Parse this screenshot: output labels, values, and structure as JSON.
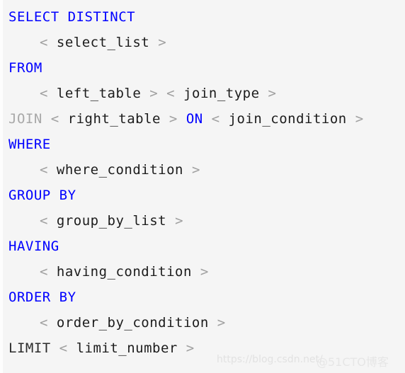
{
  "code": {
    "language": "sql",
    "background_color": "#f5f5f5",
    "keyword_color": "#0000ff",
    "placeholder_color": "#1c1c1c",
    "bracket_color": "#a0a0a0",
    "lines": [
      {
        "id": "line-select",
        "indented": false,
        "tokens": [
          {
            "text": "SELECT",
            "type": "keyword"
          },
          {
            "text": " ",
            "type": "space"
          },
          {
            "text": "DISTINCT",
            "type": "keyword"
          }
        ]
      },
      {
        "id": "line-select-list",
        "indented": true,
        "tokens": [
          {
            "text": "<",
            "type": "bracket"
          },
          {
            "text": " ",
            "type": "space"
          },
          {
            "text": "select_list",
            "type": "placeholder"
          },
          {
            "text": " ",
            "type": "space"
          },
          {
            "text": ">",
            "type": "bracket"
          }
        ]
      },
      {
        "id": "line-from",
        "indented": false,
        "tokens": [
          {
            "text": "FROM",
            "type": "keyword"
          }
        ]
      },
      {
        "id": "line-left-table",
        "indented": true,
        "tokens": [
          {
            "text": "<",
            "type": "bracket"
          },
          {
            "text": " ",
            "type": "space"
          },
          {
            "text": "left_table",
            "type": "placeholder"
          },
          {
            "text": " ",
            "type": "space"
          },
          {
            "text": ">",
            "type": "bracket"
          },
          {
            "text": " ",
            "type": "space"
          },
          {
            "text": "<",
            "type": "bracket"
          },
          {
            "text": " ",
            "type": "space"
          },
          {
            "text": "join_type",
            "type": "placeholder"
          },
          {
            "text": " ",
            "type": "space"
          },
          {
            "text": ">",
            "type": "bracket"
          }
        ]
      },
      {
        "id": "line-join",
        "indented": false,
        "tokens": [
          {
            "text": "JOIN",
            "type": "keyword-muted"
          },
          {
            "text": " ",
            "type": "space"
          },
          {
            "text": "<",
            "type": "bracket"
          },
          {
            "text": " ",
            "type": "space"
          },
          {
            "text": "right_table",
            "type": "placeholder"
          },
          {
            "text": " ",
            "type": "space"
          },
          {
            "text": ">",
            "type": "bracket"
          },
          {
            "text": " ",
            "type": "space"
          },
          {
            "text": "ON",
            "type": "keyword"
          },
          {
            "text": " ",
            "type": "space"
          },
          {
            "text": "<",
            "type": "bracket"
          },
          {
            "text": " ",
            "type": "space"
          },
          {
            "text": "join_condition",
            "type": "placeholder"
          },
          {
            "text": " ",
            "type": "space"
          },
          {
            "text": ">",
            "type": "bracket"
          }
        ]
      },
      {
        "id": "line-where",
        "indented": false,
        "tokens": [
          {
            "text": "WHERE",
            "type": "keyword"
          }
        ]
      },
      {
        "id": "line-where-condition",
        "indented": true,
        "tokens": [
          {
            "text": "<",
            "type": "bracket"
          },
          {
            "text": " ",
            "type": "space"
          },
          {
            "text": "where_condition",
            "type": "placeholder"
          },
          {
            "text": " ",
            "type": "space"
          },
          {
            "text": ">",
            "type": "bracket"
          }
        ]
      },
      {
        "id": "line-group-by",
        "indented": false,
        "tokens": [
          {
            "text": "GROUP",
            "type": "keyword"
          },
          {
            "text": " ",
            "type": "space"
          },
          {
            "text": "BY",
            "type": "keyword"
          }
        ]
      },
      {
        "id": "line-group-by-list",
        "indented": true,
        "tokens": [
          {
            "text": "<",
            "type": "bracket"
          },
          {
            "text": " ",
            "type": "space"
          },
          {
            "text": "group_by_list",
            "type": "placeholder"
          },
          {
            "text": " ",
            "type": "space"
          },
          {
            "text": ">",
            "type": "bracket"
          }
        ]
      },
      {
        "id": "line-having",
        "indented": false,
        "tokens": [
          {
            "text": "HAVING",
            "type": "keyword"
          }
        ]
      },
      {
        "id": "line-having-condition",
        "indented": true,
        "tokens": [
          {
            "text": "<",
            "type": "bracket"
          },
          {
            "text": " ",
            "type": "space"
          },
          {
            "text": "having_condition",
            "type": "placeholder"
          },
          {
            "text": " ",
            "type": "space"
          },
          {
            "text": ">",
            "type": "bracket"
          }
        ]
      },
      {
        "id": "line-order-by",
        "indented": false,
        "tokens": [
          {
            "text": "ORDER",
            "type": "keyword"
          },
          {
            "text": " ",
            "type": "space"
          },
          {
            "text": "BY",
            "type": "keyword"
          }
        ]
      },
      {
        "id": "line-order-by-condition",
        "indented": true,
        "tokens": [
          {
            "text": "<",
            "type": "bracket"
          },
          {
            "text": " ",
            "type": "space"
          },
          {
            "text": "order_by_condition",
            "type": "placeholder"
          },
          {
            "text": " ",
            "type": "space"
          },
          {
            "text": ">",
            "type": "bracket"
          }
        ]
      },
      {
        "id": "line-limit",
        "indented": false,
        "tokens": [
          {
            "text": "LIMIT",
            "type": "keyword-dark"
          },
          {
            "text": " ",
            "type": "space"
          },
          {
            "text": "<",
            "type": "bracket"
          },
          {
            "text": " ",
            "type": "space"
          },
          {
            "text": "limit_number",
            "type": "placeholder"
          },
          {
            "text": " ",
            "type": "space"
          },
          {
            "text": ">",
            "type": "bracket"
          }
        ]
      }
    ]
  },
  "watermarks": {
    "csdn": "https://blog.csdn.net/",
    "cto": "@51CTO博客"
  }
}
